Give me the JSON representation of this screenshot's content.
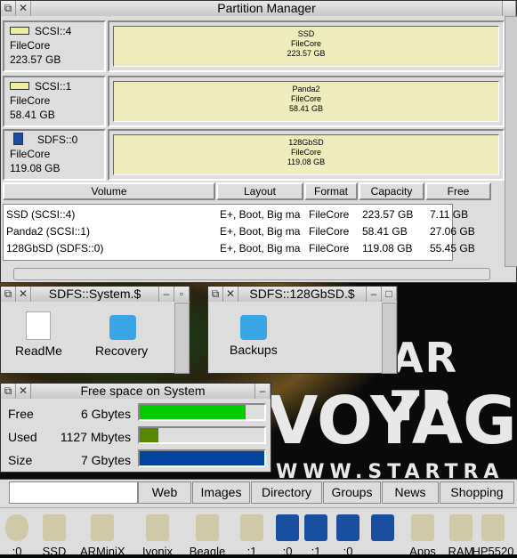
{
  "partition_manager": {
    "title": "Partition Manager",
    "disks": [
      {
        "device": "SCSI::4",
        "format": "FileCore",
        "size": "223.57 GB",
        "icon": "harddisc-icon",
        "part_name": "SSD",
        "part_format": "FileCore",
        "part_size": "223.57 GB"
      },
      {
        "device": "SCSI::1",
        "format": "FileCore",
        "size": "58.41 GB",
        "icon": "harddisc-icon",
        "part_name": "Panda2",
        "part_format": "FileCore",
        "part_size": "58.41 GB"
      },
      {
        "device": "SDFS::0",
        "format": "FileCore",
        "size": "119.08 GB",
        "icon": "sdcard-icon",
        "part_name": "128GbSD",
        "part_format": "FileCore",
        "part_size": "119.08 GB"
      }
    ],
    "columns": [
      "Volume",
      "Layout",
      "Format",
      "Capacity",
      "Free"
    ],
    "rows": [
      [
        "SSD (SCSI::4)",
        "E+, Boot, Big ma",
        "FileCore",
        "223.57 GB",
        "7.11 GB"
      ],
      [
        "Panda2 (SCSI::1)",
        "E+, Boot, Big ma",
        "FileCore",
        "58.41 GB",
        "27.06 GB"
      ],
      [
        "128GbSD (SDFS::0)",
        "E+, Boot, Big ma",
        "FileCore",
        "119.08 GB",
        "55.45 GB"
      ]
    ]
  },
  "filer1": {
    "title": "SDFS::System.$",
    "items": [
      "ReadMe",
      "Recovery"
    ]
  },
  "filer2": {
    "title": "SDFS::128GbSD.$",
    "items": [
      "Backups"
    ]
  },
  "freespace": {
    "title": "Free space on System",
    "rows": [
      {
        "label": "Free",
        "value": "6 Gbytes",
        "fraction": 0.85,
        "color": "#00cc00"
      },
      {
        "label": "Used",
        "value": "1127 Mbytes",
        "fraction": 0.15,
        "color": "#558800"
      },
      {
        "label": "Size",
        "value": "7 Gbytes",
        "fraction": 1.0,
        "color": "#0044a0"
      }
    ]
  },
  "background": {
    "line1": "AR TR",
    "line2": "VOYAG",
    "line3": "WWW.STARTRA"
  },
  "search": {
    "value": "",
    "buttons": [
      "Web",
      "Images",
      "Directory",
      "Groups",
      "News",
      "Shopping"
    ]
  },
  "iconbar": [
    "0",
    ":0",
    "SSD",
    "ARMiniX",
    "Ivonix",
    "Beagle",
    ":1",
    ":0",
    ":1",
    ":0",
    "",
    "Apps",
    "RAM",
    "HP5520"
  ]
}
